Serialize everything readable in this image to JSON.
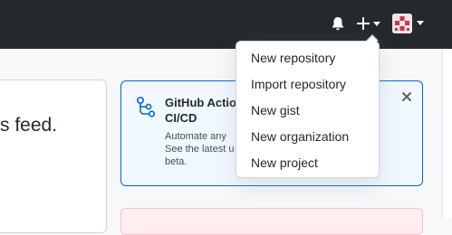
{
  "header": {
    "notifications_icon": "bell-icon",
    "create_icon": "plus-icon",
    "avatar_icon": "identicon-avatar",
    "background": "#24292e"
  },
  "feed": {
    "text": "s feed."
  },
  "actions_card": {
    "title_line1": "GitHub Actio",
    "title_line2": "CI/CD",
    "description_lines": [
      "Automate any",
      "See the latest u",
      "beta."
    ],
    "trailing_dot": ".",
    "icon": "workflow-icon",
    "close_icon": "close-icon",
    "border_color": "#0366d6",
    "background": "#f1f8ff"
  },
  "create_menu": {
    "items": [
      "New repository",
      "Import repository",
      "New gist",
      "New organization",
      "New project"
    ]
  }
}
